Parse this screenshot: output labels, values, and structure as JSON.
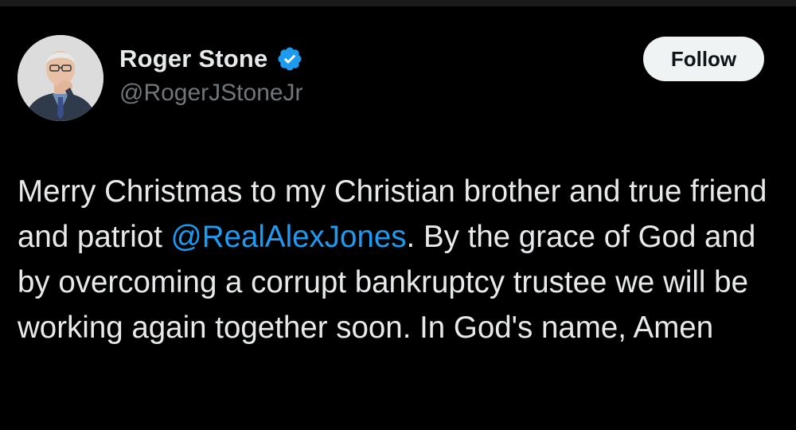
{
  "author": {
    "display_name": "Roger Stone",
    "handle": "@RogerJStoneJr",
    "verified": true,
    "avatar_icon": "profile-photo"
  },
  "follow_button": {
    "label": "Follow"
  },
  "tweet": {
    "text_before_mention": "Merry Christmas to my Christian brother and true friend and patriot ",
    "mention": "@RealAlexJones",
    "text_after_mention": ". By the grace of God and by overcoming a corrupt bankruptcy trustee we will be working again together soon. In God's name, Amen"
  },
  "colors": {
    "background": "#000000",
    "text": "#e7e9ea",
    "secondary_text": "#71767b",
    "link": "#1d9bf0",
    "verified_badge": "#1d9bf0",
    "follow_button_bg": "#eff3f4",
    "follow_button_text": "#0f1419"
  }
}
